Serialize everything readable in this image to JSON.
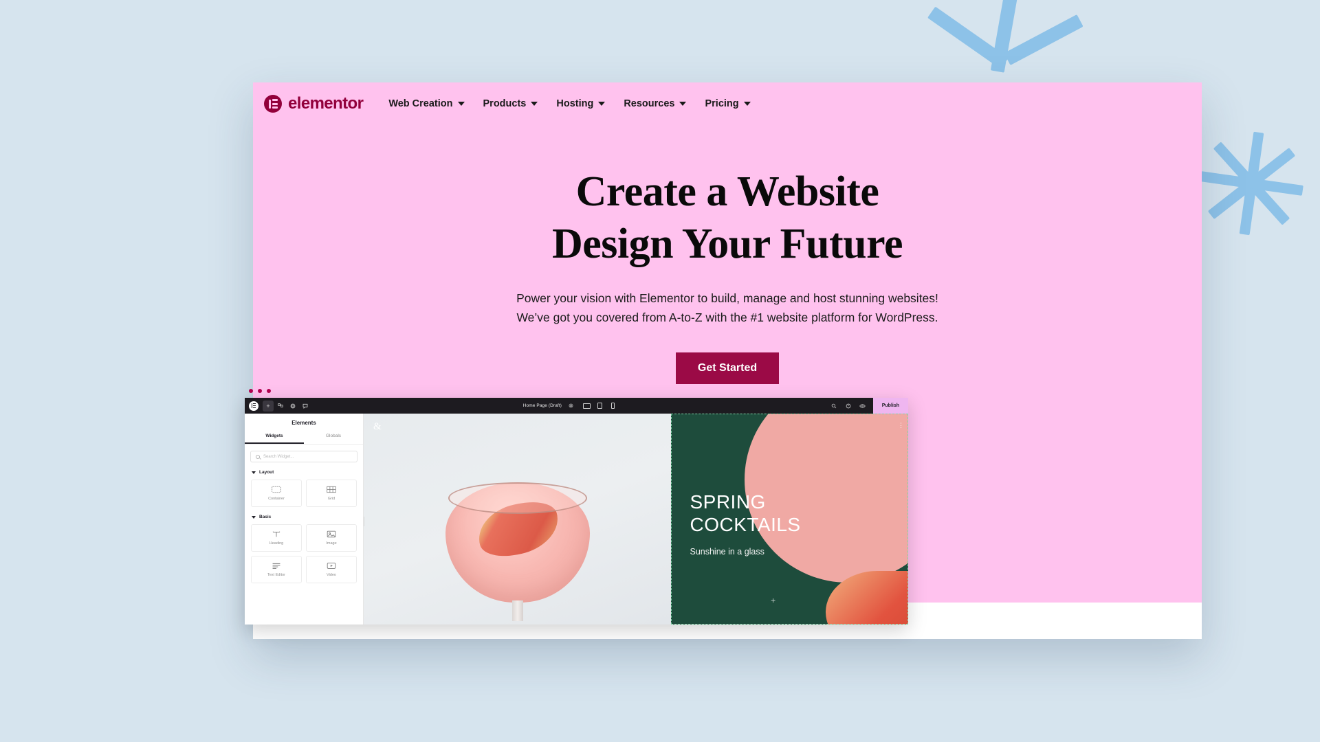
{
  "theme": {
    "page_bg": "#d6e4ee",
    "hero_bg": "#ffc2ee",
    "brand": "#92003B",
    "cta_bg": "#9B0A46",
    "deco": "#8dc2e8",
    "editor_bar": "#1d1b20",
    "publish_bg": "#efb6f0",
    "canvas_green": "#1e4c3c"
  },
  "nav": {
    "logo_text": "elementor",
    "logo_icon": "elementor-logo-icon",
    "items": [
      {
        "label": "Web Creation",
        "icon": "chevron-down-icon"
      },
      {
        "label": "Products",
        "icon": "chevron-down-icon"
      },
      {
        "label": "Hosting",
        "icon": "chevron-down-icon"
      },
      {
        "label": "Resources",
        "icon": "chevron-down-icon"
      },
      {
        "label": "Pricing",
        "icon": "chevron-down-icon"
      }
    ]
  },
  "hero": {
    "headline_line1": "Create a Website",
    "headline_line2": "Design Your Future",
    "subcopy_line1": "Power your vision with Elementor to build, manage and host stunning websites!",
    "subcopy_line2": "We’ve got you covered from A-to-Z with the #1 website platform for WordPress.",
    "cta_label": "Get Started"
  },
  "editor": {
    "window_dots_icon": "window-dots-icon",
    "toolbar": {
      "logo_icon": "elementor-logo-icon",
      "add_icon": "plus-icon",
      "structure_icon": "site-structure-icon",
      "settings_icon": "settings-gear-icon",
      "notes_icon": "notes-comment-icon",
      "page_title": "Home Page (Draft)",
      "page_settings_icon": "page-settings-icon",
      "devices": [
        {
          "icon": "desktop-icon"
        },
        {
          "icon": "tablet-icon"
        },
        {
          "icon": "mobile-icon"
        }
      ],
      "finder_icon": "search-finder-icon",
      "history_icon": "history-icon",
      "preview_icon": "preview-eye-icon",
      "publish_label": "Publish"
    },
    "panel": {
      "title": "Elements",
      "tabs": [
        {
          "label": "Widgets",
          "active": true
        },
        {
          "label": "Globals",
          "active": false
        }
      ],
      "search_placeholder": "Search Widget...",
      "search_icon": "search-icon",
      "sections": [
        {
          "label": "Layout",
          "widgets": [
            {
              "label": "Container",
              "icon": "container-icon"
            },
            {
              "label": "Grid",
              "icon": "grid-icon"
            }
          ]
        },
        {
          "label": "Basic",
          "widgets": [
            {
              "label": "Heading",
              "icon": "heading-t-icon"
            },
            {
              "label": "Image",
              "icon": "image-icon"
            },
            {
              "label": "Text Editor",
              "icon": "text-editor-icon"
            },
            {
              "label": "Video",
              "icon": "video-play-icon"
            }
          ]
        }
      ]
    },
    "canvas": {
      "ampersand": "&",
      "heading_line1": "SPRING",
      "heading_line2": "COCKTAILS",
      "subheading": "Sunshine in a glass",
      "selection_tools": [
        {
          "icon": "close-x-icon",
          "glyph": "×"
        },
        {
          "icon": "drag-grip-icon",
          "glyph": "∷"
        },
        {
          "icon": "add-plus-icon",
          "glyph": "+"
        }
      ],
      "options_icon": "more-options-icon",
      "add_section_icon": "add-plus-icon",
      "resize_handle_icon": "resize-handle-icon"
    }
  }
}
